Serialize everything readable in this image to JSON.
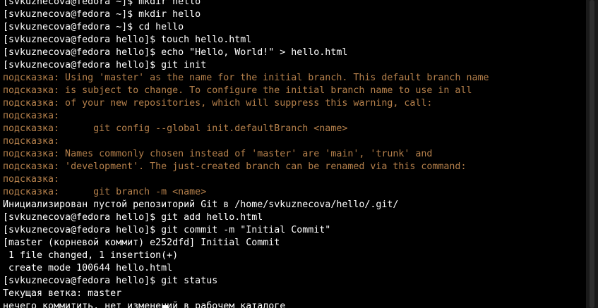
{
  "colors": {
    "background": "#000000",
    "text": "#ffffff",
    "hint": "#b5804b"
  },
  "terminal": {
    "lines": [
      {
        "text": "[svkuznecova@fedora ~]$ mkdir hello",
        "type": "normal"
      },
      {
        "text": "[svkuznecova@fedora ~]$ mkdir hello",
        "type": "normal"
      },
      {
        "text": "[svkuznecova@fedora ~]$ cd hello",
        "type": "normal"
      },
      {
        "text": "[svkuznecova@fedora hello]$ touch hello.html",
        "type": "normal"
      },
      {
        "text": "[svkuznecova@fedora hello]$ echo \"Hello, World!\" > hello.html",
        "type": "normal"
      },
      {
        "text": "[svkuznecova@fedora hello]$ git init",
        "type": "normal"
      },
      {
        "text": "подсказка: Using 'master' as the name for the initial branch. This default branch name",
        "type": "hint"
      },
      {
        "text": "подсказка: is subject to change. To configure the initial branch name to use in all",
        "type": "hint"
      },
      {
        "text": "подсказка: of your new repositories, which will suppress this warning, call:",
        "type": "hint"
      },
      {
        "text": "подсказка:",
        "type": "hint"
      },
      {
        "text": "подсказка:      git config --global init.defaultBranch <name>",
        "type": "hint"
      },
      {
        "text": "подсказка:",
        "type": "hint"
      },
      {
        "text": "подсказка: Names commonly chosen instead of 'master' are 'main', 'trunk' and",
        "type": "hint"
      },
      {
        "text": "подсказка: 'development'. The just-created branch can be renamed via this command:",
        "type": "hint"
      },
      {
        "text": "подсказка:",
        "type": "hint"
      },
      {
        "text": "подсказка:      git branch -m <name>",
        "type": "hint"
      },
      {
        "text": "Инициализирован пустой репозиторий Git в /home/svkuznecova/hello/.git/",
        "type": "normal"
      },
      {
        "text": "[svkuznecova@fedora hello]$ git add hello.html",
        "type": "normal"
      },
      {
        "text": "[svkuznecova@fedora hello]$ git commit -m \"Initial Commit\"",
        "type": "normal"
      },
      {
        "text": "[master (корневой коммит) e252dfd] Initial Commit",
        "type": "normal"
      },
      {
        "text": " 1 file changed, 1 insertion(+)",
        "type": "normal"
      },
      {
        "text": " create mode 100644 hello.html",
        "type": "normal"
      },
      {
        "text": "[svkuznecova@fedora hello]$ git status",
        "type": "normal"
      },
      {
        "text": "Текущая ветка: master",
        "type": "normal"
      },
      {
        "text": "нечего коммитить, нет изменений в рабочем каталоге",
        "type": "normal"
      }
    ]
  }
}
